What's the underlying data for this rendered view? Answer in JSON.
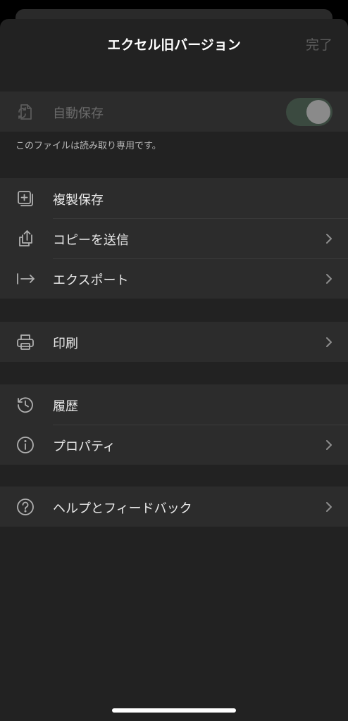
{
  "header": {
    "title": "エクセル旧バージョン",
    "done_label": "完了"
  },
  "autosave": {
    "label": "自動保存",
    "icon": "autosave-icon",
    "toggle_on": true,
    "note": "このファイルは読み取り専用です。"
  },
  "group_file": {
    "items": [
      {
        "label": "複製保存",
        "icon": "duplicate-icon"
      },
      {
        "label": "コピーを送信",
        "icon": "share-icon"
      },
      {
        "label": "エクスポート",
        "icon": "export-icon"
      }
    ]
  },
  "group_print": {
    "items": [
      {
        "label": "印刷",
        "icon": "printer-icon"
      }
    ]
  },
  "group_info": {
    "items": [
      {
        "label": "履歴",
        "icon": "history-icon"
      },
      {
        "label": "プロパティ",
        "icon": "info-icon"
      }
    ]
  },
  "group_help": {
    "items": [
      {
        "label": "ヘルプとフィードバック",
        "icon": "help-icon"
      }
    ]
  },
  "colors": {
    "background": "#222222",
    "row_background": "#2c2c2c",
    "toggle_track": "#3b4a40",
    "chevron": "#8e8e8e",
    "icon": "#b0b0b0"
  }
}
